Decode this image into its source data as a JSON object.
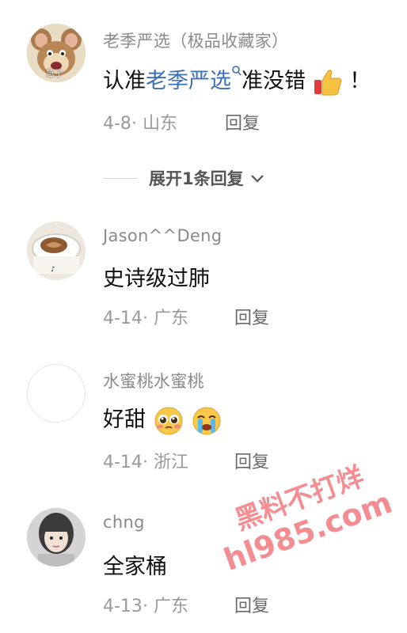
{
  "comments": [
    {
      "username": "老季严选（极品收藏家）",
      "content_prefix": "认准",
      "content_link": "老季严选",
      "content_suffix": "准没错",
      "content_end": "！",
      "date": "4-8",
      "location": "山东",
      "reply_label": "回复",
      "avatar_icon": "cartoon-mouse-icon",
      "avatar_caption": "急了",
      "emojis": [
        "thumbs-up-icon"
      ]
    },
    {
      "username": "Jason^^Deng",
      "content": "史诗级过肺",
      "date": "4-14",
      "location": "广东",
      "reply_label": "回复",
      "avatar_icon": "latte-cup-icon"
    },
    {
      "username": "水蜜桃水蜜桃",
      "content": "好甜",
      "date": "4-14",
      "location": "浙江",
      "reply_label": "回复",
      "avatar_icon": "empty-avatar-icon",
      "emojis": [
        "pleading-face-icon",
        "crying-face-icon"
      ]
    },
    {
      "username": "chng",
      "content": "全家桶",
      "date": "4-13",
      "location": "广东",
      "reply_label": "回复",
      "avatar_icon": "person-photo-icon"
    }
  ],
  "expand_replies": {
    "label": "展开1条回复"
  },
  "watermark": {
    "line1": "黑料不打烊",
    "line2": "hl985.com"
  },
  "colors": {
    "link": "#3b6fb6",
    "meta": "#9a9a9a",
    "watermark": "#eb2d37"
  }
}
